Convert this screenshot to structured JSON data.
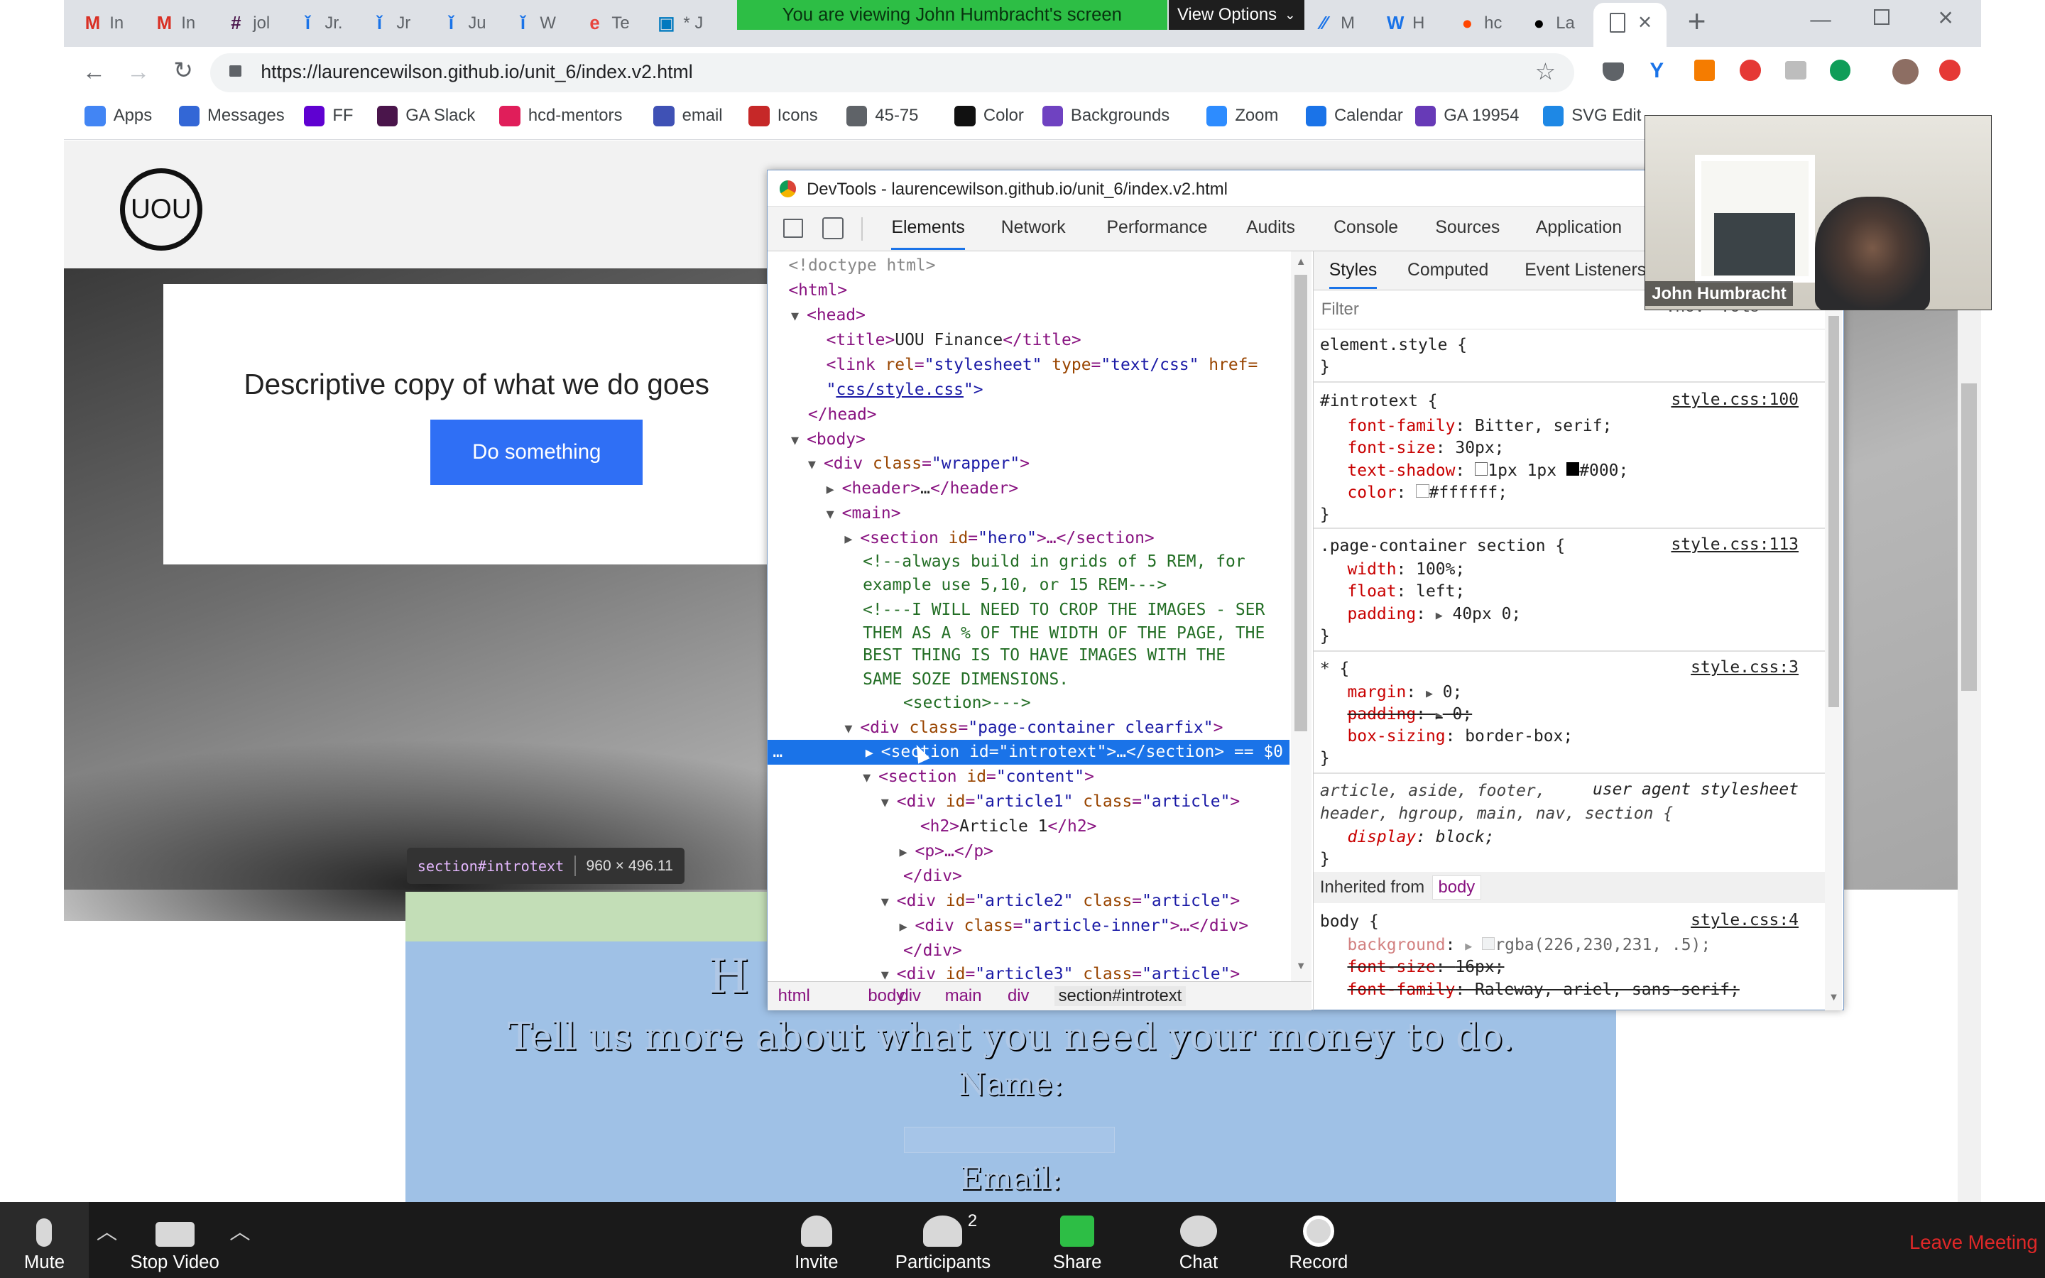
{
  "screen_share": {
    "banner": "You are viewing John Humbracht's screen",
    "view_options": "View Options"
  },
  "browser": {
    "tabs": [
      {
        "icon": "gmail-icon",
        "label": "In",
        "color": "#d93025"
      },
      {
        "icon": "gmail-icon",
        "label": "In",
        "color": "#d93025"
      },
      {
        "icon": "slack-icon",
        "label": "jol",
        "color": "#4a154b"
      },
      {
        "icon": "info-icon",
        "label": "Jr.",
        "color": "#1a73e8"
      },
      {
        "icon": "info-icon",
        "label": "Jr",
        "color": "#1a73e8"
      },
      {
        "icon": "info-icon",
        "label": "Ju",
        "color": "#1a73e8"
      },
      {
        "icon": "info-icon",
        "label": "W",
        "color": "#1a73e8"
      },
      {
        "icon": "e-icon",
        "label": "Te",
        "color": "#e8453c"
      },
      {
        "icon": "trello-icon",
        "label": "* J",
        "color": "#0079bf"
      },
      {
        "icon": "stripe-icon",
        "label": "M",
        "color": "#1a73e8"
      },
      {
        "icon": "w-icon",
        "label": "H",
        "color": "#1a73e8"
      },
      {
        "icon": "reddit-icon",
        "label": "hc",
        "color": "#ff4500"
      },
      {
        "icon": "github-icon",
        "label": "La",
        "color": "#000000"
      },
      {
        "icon": "page-icon",
        "label": "",
        "color": "#5f6368"
      }
    ],
    "url": "https://laurencewilson.github.io/unit_6/index.v2.html",
    "bookmarks": [
      "Apps",
      "Messages",
      "FF",
      "GA Slack",
      "hcd-mentors",
      "email",
      "Icons",
      "45-75",
      "Color",
      "Backgrounds",
      "Zoom",
      "Calendar",
      "GA 19954",
      "SVG Edit"
    ]
  },
  "page": {
    "logo": "UOU",
    "hero_copy": "Descriptive copy of what we do goes",
    "hero_button": "Do something",
    "inspector_tooltip": {
      "selector": "section#introtext",
      "size": "960 × 496.11"
    },
    "introtext_heading": "H",
    "introtext_line": "Tell us more about what you need your money to do.",
    "name_label": "Name:",
    "email_label": "Email:"
  },
  "devtools": {
    "title": "DevTools - laurencewilson.github.io/unit_6/index.v2.html",
    "tabs": [
      "Elements",
      "Network",
      "Performance",
      "Audits",
      "Console",
      "Sources",
      "Application"
    ],
    "active_tab": "Elements",
    "dom": {
      "l1": "<!doctype html>",
      "l2": "<html>",
      "l3": "<head>",
      "l4a": "<title>",
      "l4b": "UOU Finance",
      "l4c": "</title>",
      "l5a": "<link ",
      "l5b": "rel",
      "l5c": "\"stylesheet\"",
      "l5d": "type",
      "l5e": "\"text/css\"",
      "l5f": "href=",
      "l6a": "\"",
      "l6b": "css/style.css",
      "l6c": "\">",
      "l7": "</head>",
      "l8": "<body>",
      "l9a": "<div ",
      "l9b": "class",
      "l9c": "\"wrapper\"",
      "l10a": "<header>",
      "l10b": "…",
      "l10c": "</header>",
      "l11": "<main>",
      "l12a": "<section ",
      "l12b": "id",
      "l12c": "\"hero\"",
      "l12d": ">…</section>",
      "c1": "<!--always build in grids of 5 REM, for",
      "c2": "example use 5,10, or 15 REM--->",
      "c3": "<!---I WILL NEED TO CROP THE IMAGES - SER",
      "c4": "THEM AS A % OF THE WIDTH OF THE PAGE, THE",
      "c5": "BEST THING IS TO HAVE IMAGES WITH THE",
      "c6": "SAME SOZE DIMENSIONS.",
      "c7": "<section>--->",
      "l13a": "<div ",
      "l13b": "class",
      "l13c": "\"page-container clearfix\"",
      "sel_a": "<section ",
      "sel_b": "id",
      "sel_c": "\"introtext\"",
      "sel_d": ">…</section>",
      "sel_e": "== $0",
      "l15a": "<section ",
      "l15b": "id",
      "l15c": "\"content\"",
      "l16a": "<div ",
      "l16b": "id",
      "l16c": "\"article1\"",
      "l16d": "class",
      "l16e": "\"article\"",
      "l17a": "<h2>",
      "l17b": "Article 1",
      "l17c": "</h2>",
      "l18": "<p>…</p>",
      "l19": "</div>",
      "l20a": "<div ",
      "l20b": "id",
      "l20c": "\"article2\"",
      "l20d": "class",
      "l20e": "\"article\"",
      "l21a": "<div ",
      "l21b": "class",
      "l21c": "\"article-inner\"",
      "l21d": ">…</div>",
      "l22": "</div>",
      "l23a": "<div ",
      "l23b": "id",
      "l23c": "\"article3\"",
      "l23d": "class",
      "l23e": "\"article\""
    },
    "breadcrumb": [
      "html",
      "body",
      "div",
      "main",
      "div",
      "section#introtext"
    ],
    "styles_tabs": [
      "Styles",
      "Computed",
      "Event Listeners"
    ],
    "filter_placeholder": "Filter",
    "hov": ":hov",
    "cls": ".cls",
    "rules": {
      "element_style": "element.style {",
      "close": "}",
      "r1_selector": "#introtext {",
      "r1_src": "style.css:100",
      "r1_p1": "font-family",
      "r1_v1": "Bitter, serif;",
      "r1_p2": "font-size",
      "r1_v2": "30px;",
      "r1_p3": "text-shadow",
      "r1_v3a": "1px 1px",
      "r1_v3b": "#000;",
      "r1_p4": "color",
      "r1_v4": "#ffffff;",
      "r2_selector": ".page-container section {",
      "r2_src": "style.css:113",
      "r2_p1": "width",
      "r2_v1": "100%;",
      "r2_p2": "float",
      "r2_v2": "left;",
      "r2_p3": "padding",
      "r2_v3": "40px 0;",
      "r3_selector": "* {",
      "r3_src": "style.css:3",
      "r3_p1": "margin",
      "r3_v1": "0;",
      "r3_p2": "padding",
      "r3_v2": "0;",
      "r3_p3": "box-sizing",
      "r3_v3": "border-box;",
      "r4_sel1": "article, aside, footer,",
      "r4_src": "user agent stylesheet",
      "r4_sel2": "header, hgroup, main, nav, section {",
      "r4_p1": "display",
      "r4_v1": "block;",
      "inherited": "Inherited from",
      "inherited_tag": "body",
      "r5_selector": "body {",
      "r5_src": "style.css:4",
      "r5_p1": "background",
      "r5_v1": "rgba(226,230,231, .5);",
      "r5_p2": "font-size",
      "r5_v2": "16px;",
      "r5_p3": "font-family",
      "r5_v3": "Raleway, ariel, sans-serif;"
    }
  },
  "video": {
    "participant_name": "John Humbracht"
  },
  "zoom": {
    "mute": "Mute",
    "stop_video": "Stop Video",
    "invite": "Invite",
    "participants": "Participants",
    "participants_count": "2",
    "share": "Share",
    "chat": "Chat",
    "record": "Record",
    "leave": "Leave Meeting"
  }
}
